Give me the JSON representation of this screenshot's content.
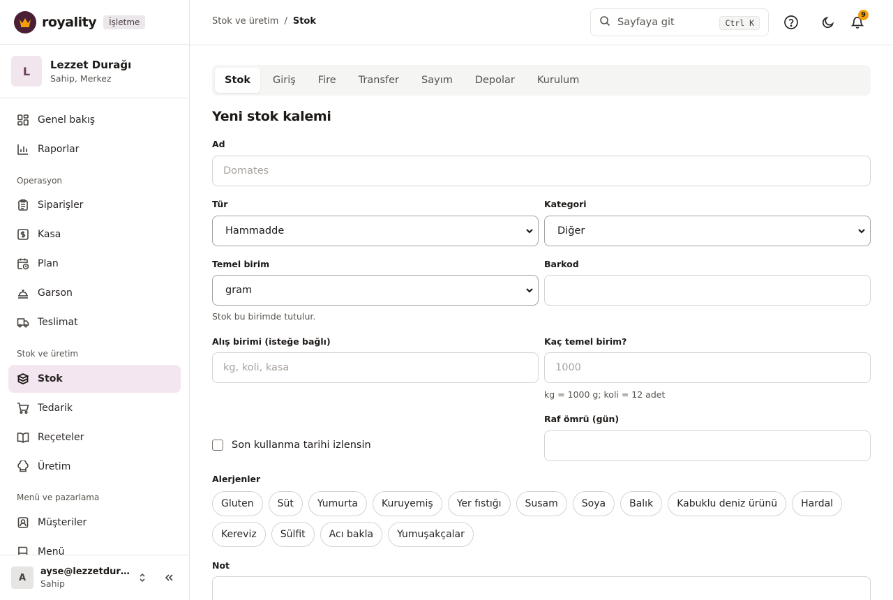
{
  "brand": {
    "name": "royality",
    "badge": "İşletme",
    "logo_color": "#4a1f36"
  },
  "org": {
    "initial": "L",
    "name": "Lezzet Durağı",
    "role": "Sahip, Merkez"
  },
  "nav": {
    "top": [
      {
        "label": "Genel bakış",
        "icon": "layout-grid-icon"
      },
      {
        "label": "Raporlar",
        "icon": "bar-chart-icon"
      }
    ],
    "sections": [
      {
        "title": "Operasyon",
        "items": [
          {
            "label": "Siparişler",
            "icon": "clipboard-list-icon"
          },
          {
            "label": "Kasa",
            "icon": "cash-register-icon"
          },
          {
            "label": "Plan",
            "icon": "calendar-clock-icon"
          },
          {
            "label": "Garson",
            "icon": "concierge-bell-icon"
          },
          {
            "label": "Teslimat",
            "icon": "truck-icon"
          }
        ]
      },
      {
        "title": "Stok ve üretim",
        "items": [
          {
            "label": "Stok",
            "icon": "database-stack-icon",
            "active": true
          },
          {
            "label": "Tedarik",
            "icon": "shopping-cart-icon"
          },
          {
            "label": "Reçeteler",
            "icon": "book-open-icon"
          },
          {
            "label": "Üretim",
            "icon": "chef-hat-icon"
          }
        ]
      },
      {
        "title": "Menü ve pazarlama",
        "items": [
          {
            "label": "Müşteriler",
            "icon": "contact-icon"
          },
          {
            "label": "Menü",
            "icon": "menu-book-icon"
          }
        ]
      }
    ]
  },
  "user": {
    "initial": "A",
    "email": "ayse@lezzetdurağı.com",
    "role": "Sahip"
  },
  "header": {
    "breadcrumb": {
      "parent": "Stok ve üretim",
      "separator": "/",
      "current": "Stok"
    },
    "search": {
      "placeholder": "Sayfaya git",
      "shortcut": "Ctrl K"
    },
    "notifications_count": "9"
  },
  "tabs": [
    "Stok",
    "Giriş",
    "Fire",
    "Transfer",
    "Sayım",
    "Depolar",
    "Kurulum"
  ],
  "active_tab": "Stok",
  "form": {
    "title": "Yeni stok kalemi",
    "name": {
      "label": "Ad",
      "placeholder": "Domates"
    },
    "type": {
      "label": "Tür",
      "value": "Hammadde"
    },
    "category": {
      "label": "Kategori",
      "value": "Diğer"
    },
    "base_unit": {
      "label": "Temel birim",
      "value": "gram",
      "hint": "Stok bu birimde tutulur."
    },
    "barcode": {
      "label": "Barkod",
      "value": ""
    },
    "purchase_unit": {
      "label": "Alış birimi (isteğe bağlı)",
      "placeholder": "kg, koli, kasa"
    },
    "conversion": {
      "label": "Kaç temel birim?",
      "placeholder": "1000",
      "hint": "kg = 1000 g; koli = 12 adet"
    },
    "expiry_tracking": {
      "label": "Son kullanma tarihi izlensin",
      "checked": false
    },
    "shelf_life": {
      "label": "Raf ömrü (gün)",
      "value": ""
    },
    "allergens": {
      "label": "Alerjenler",
      "items": [
        "Gluten",
        "Süt",
        "Yumurta",
        "Kuruyemiş",
        "Yer fıstığı",
        "Susam",
        "Soya",
        "Balık",
        "Kabuklu deniz ürünü",
        "Hardal",
        "Kereviz",
        "Sülfit",
        "Acı bakla",
        "Yumuşakçalar"
      ]
    },
    "note": {
      "label": "Not",
      "value": ""
    }
  }
}
